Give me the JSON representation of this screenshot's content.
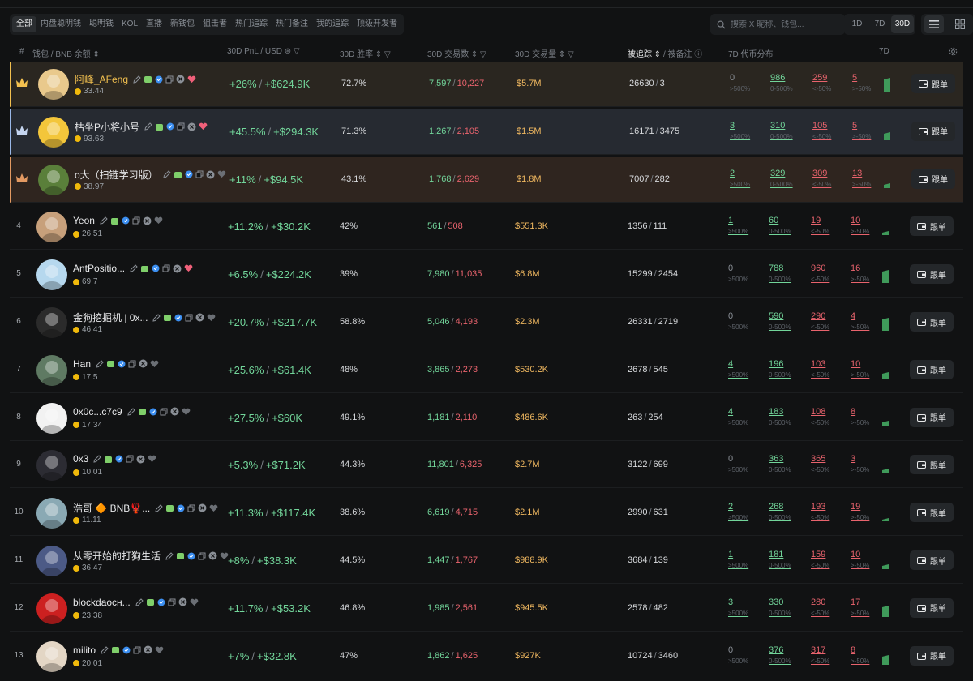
{
  "filter_tabs": [
    "全部",
    "内盘聪明钱",
    "聪明钱",
    "KOL",
    "直播",
    "新钱包",
    "狙击者",
    "热门追踪",
    "热门备注",
    "我的追踪",
    "顶级开发者"
  ],
  "search": {
    "placeholder": "搜索 X 昵称、钱包..."
  },
  "periods": [
    "1D",
    "7D",
    "30D"
  ],
  "header": {
    "rank": "#",
    "wallet": "钱包 / BNB 余额",
    "pnl": "30D PnL / USD",
    "winrate": "30D 胜率",
    "txs": "30D 交易数",
    "volume": "30D 交易量",
    "followers_a": "被追踪",
    "followers_b": "/ 被备注",
    "distribution": "7D 代币分布",
    "spark": "7D"
  },
  "dist_labels": [
    ">500%",
    "0-500%",
    "<-50%",
    ">-50%"
  ],
  "follow_label": "跟单",
  "colors": {
    "gain": "#72d59a",
    "loss": "#e8636d",
    "volume": "#f0b860",
    "gold": "#f2c04f"
  },
  "rows": [
    {
      "rank": "1",
      "name": "阿峰_AFeng",
      "balance": "33.44",
      "pnl_pct": "+26%",
      "pnl_usd": "+$624.9K",
      "winrate": "72.7%",
      "buys": "7,597",
      "sells": "10,227",
      "volume": "$5.7M",
      "followers": "26630",
      "notes": "3",
      "d0": "0",
      "d1": "986",
      "d2": "259",
      "d3": "5",
      "heart": true
    },
    {
      "rank": "2",
      "name": "枯坐P小将小号",
      "balance": "93.63",
      "pnl_pct": "+45.5%",
      "pnl_usd": "+$294.3K",
      "winrate": "71.3%",
      "buys": "1,267",
      "sells": "2,105",
      "volume": "$1.5M",
      "followers": "16171",
      "notes": "3475",
      "d0": "3",
      "d1": "310",
      "d2": "105",
      "d3": "5",
      "heart": true
    },
    {
      "rank": "3",
      "name": "o大（扫链学习版）",
      "balance": "38.97",
      "pnl_pct": "+11%",
      "pnl_usd": "+$94.5K",
      "winrate": "43.1%",
      "buys": "1,768",
      "sells": "2,629",
      "volume": "$1.8M",
      "followers": "7007",
      "notes": "282",
      "d0": "2",
      "d1": "329",
      "d2": "309",
      "d3": "13",
      "heart": false
    },
    {
      "rank": "4",
      "name": "Yeon",
      "balance": "26.51",
      "pnl_pct": "+11.2%",
      "pnl_usd": "+$30.2K",
      "winrate": "42%",
      "buys": "561",
      "sells": "508",
      "volume": "$551.3K",
      "followers": "1356",
      "notes": "111",
      "d0": "1",
      "d1": "60",
      "d2": "19",
      "d3": "10",
      "heart": false
    },
    {
      "rank": "5",
      "name": "AntPositio...",
      "balance": "69.7",
      "pnl_pct": "+6.5%",
      "pnl_usd": "+$224.2K",
      "winrate": "39%",
      "buys": "7,980",
      "sells": "11,035",
      "volume": "$6.8M",
      "followers": "15299",
      "notes": "2454",
      "d0": "0",
      "d1": "788",
      "d2": "960",
      "d3": "16",
      "heart": true
    },
    {
      "rank": "6",
      "name": "金狗挖掘机 | 0x...",
      "balance": "46.41",
      "pnl_pct": "+20.7%",
      "pnl_usd": "+$217.7K",
      "winrate": "58.8%",
      "buys": "5,046",
      "sells": "4,193",
      "volume": "$2.3M",
      "followers": "26331",
      "notes": "2719",
      "d0": "0",
      "d1": "590",
      "d2": "290",
      "d3": "4",
      "heart": false
    },
    {
      "rank": "7",
      "name": "Han",
      "balance": "17.5",
      "pnl_pct": "+25.6%",
      "pnl_usd": "+$61.4K",
      "winrate": "48%",
      "buys": "3,865",
      "sells": "2,273",
      "volume": "$530.2K",
      "followers": "2678",
      "notes": "545",
      "d0": "4",
      "d1": "196",
      "d2": "103",
      "d3": "10",
      "heart": false
    },
    {
      "rank": "8",
      "name": "0x0c...c7c9",
      "balance": "17.34",
      "pnl_pct": "+27.5%",
      "pnl_usd": "+$60K",
      "winrate": "49.1%",
      "buys": "1,181",
      "sells": "2,110",
      "volume": "$486.6K",
      "followers": "263",
      "notes": "254",
      "d0": "4",
      "d1": "183",
      "d2": "108",
      "d3": "8",
      "heart": false
    },
    {
      "rank": "9",
      "name": "0x3",
      "balance": "10.01",
      "pnl_pct": "+5.3%",
      "pnl_usd": "+$71.2K",
      "winrate": "44.3%",
      "buys": "11,801",
      "sells": "6,325",
      "volume": "$2.7M",
      "followers": "3122",
      "notes": "699",
      "d0": "0",
      "d1": "363",
      "d2": "365",
      "d3": "3",
      "heart": false
    },
    {
      "rank": "10",
      "name": "浩哥 🔶 BNB🦞...",
      "balance": "11.11",
      "pnl_pct": "+11.3%",
      "pnl_usd": "+$117.4K",
      "winrate": "38.6%",
      "buys": "6,619",
      "sells": "4,715",
      "volume": "$2.1M",
      "followers": "2990",
      "notes": "631",
      "d0": "2",
      "d1": "268",
      "d2": "193",
      "d3": "19",
      "heart": false
    },
    {
      "rank": "11",
      "name": "从零开始的打狗生活",
      "balance": "36.47",
      "pnl_pct": "+8%",
      "pnl_usd": "+$38.3K",
      "winrate": "44.5%",
      "buys": "1,447",
      "sells": "1,767",
      "volume": "$988.9K",
      "followers": "3684",
      "notes": "139",
      "d0": "1",
      "d1": "181",
      "d2": "159",
      "d3": "10",
      "heart": false
    },
    {
      "rank": "12",
      "name": "blockdaocʜ...",
      "balance": "23.38",
      "pnl_pct": "+11.7%",
      "pnl_usd": "+$53.2K",
      "winrate": "46.8%",
      "buys": "1,985",
      "sells": "2,561",
      "volume": "$945.5K",
      "followers": "2578",
      "notes": "482",
      "d0": "3",
      "d1": "330",
      "d2": "280",
      "d3": "17",
      "heart": false
    },
    {
      "rank": "13",
      "name": "milito",
      "balance": "20.01",
      "pnl_pct": "+7%",
      "pnl_usd": "+$32.8K",
      "winrate": "47%",
      "buys": "1,862",
      "sells": "1,625",
      "volume": "$927K",
      "followers": "10724",
      "notes": "3460",
      "d0": "0",
      "d1": "376",
      "d2": "317",
      "d3": "8",
      "heart": false
    }
  ]
}
